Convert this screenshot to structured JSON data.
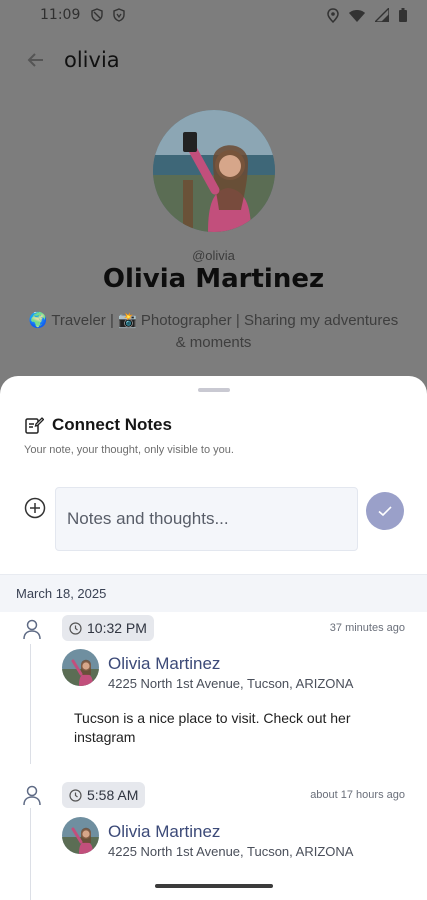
{
  "status_bar": {
    "time": "11:09"
  },
  "app_bar": {
    "title": "olivia"
  },
  "profile": {
    "handle": "@olivia",
    "name": "Olivia Martinez",
    "bio": "🌍 Traveler | 📸 Photographer | Sharing my adventures & moments"
  },
  "sheet": {
    "title": "Connect Notes",
    "subtitle": "Your note, your thought, only visible to you.",
    "input_placeholder": "Notes and thoughts...",
    "date": "March 18, 2025",
    "entries": [
      {
        "time": "10:32 PM",
        "relative": "37 minutes ago",
        "name": "Olivia Martinez",
        "address": "4225 North 1st Avenue, Tucson, ARIZONA",
        "note": "Tucson is a nice place to visit. Check out her instagram"
      },
      {
        "time": "5:58 AM",
        "relative": "about 17 hours ago",
        "name": "Olivia Martinez",
        "address": "4225 North 1st Avenue, Tucson, ARIZONA"
      }
    ]
  },
  "colors": {
    "accent": "#9aa0c9",
    "contact_name": "#3c4a78",
    "scrim": "#7d7d7d"
  }
}
